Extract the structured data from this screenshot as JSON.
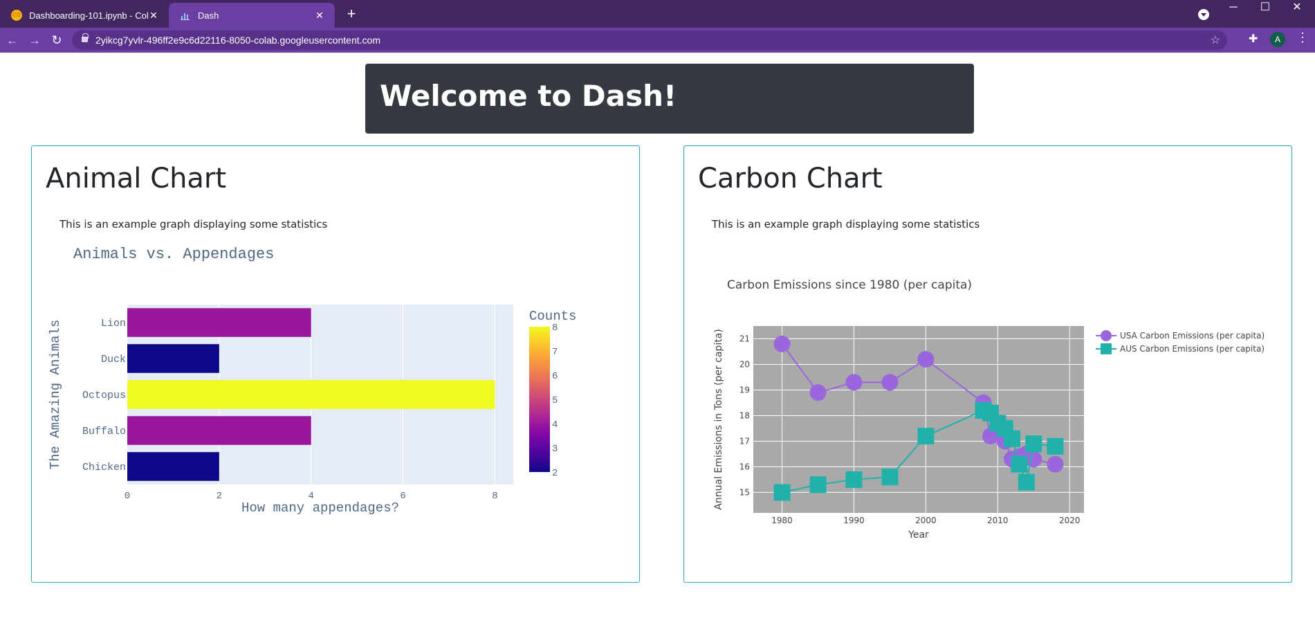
{
  "browser": {
    "tabs": [
      {
        "title": "Dashboarding-101.ipynb - Colab",
        "icon": "colab-icon",
        "active": false
      },
      {
        "title": "Dash",
        "icon": "chart-icon",
        "active": true
      }
    ],
    "url": "2yikcg7yvlr-496ff2e9c6d22116-8050-colab.googleusercontent.com",
    "profile_initial": "A"
  },
  "page": {
    "banner": "Welcome to Dash!",
    "left_card": {
      "title": "Animal Chart",
      "description": "This is an example graph displaying some statistics"
    },
    "right_card": {
      "title": "Carbon Chart",
      "description": "This is an example graph displaying some statistics"
    }
  },
  "colors": {
    "usa": "#9966dd",
    "aus": "#20b2aa",
    "plot_bg_left": "#e5ecf6",
    "plot_bg_right": "#a9a9a9"
  },
  "chart_data": [
    {
      "type": "bar",
      "orientation": "horizontal",
      "title": "Animals vs. Appendages",
      "xlabel": "How many appendages?",
      "ylabel": "The Amazing Animals",
      "categories": [
        "Lion",
        "Duck",
        "Octopus",
        "Buffalo",
        "Chicken"
      ],
      "values": [
        4,
        2,
        8,
        4,
        2
      ],
      "xlim": [
        0,
        8.4
      ],
      "xticks": [
        0,
        2,
        4,
        6,
        8
      ],
      "colorbar": {
        "title": "Counts",
        "range": [
          2,
          8
        ],
        "ticks": [
          2,
          3,
          4,
          5,
          6,
          7,
          8
        ]
      },
      "grid": true
    },
    {
      "type": "line",
      "title": "Carbon Emissions since 1980 (per capita)",
      "xlabel": "Year",
      "ylabel": "Annual Emissions in Tons (per capita)",
      "xlim": [
        1976,
        2022
      ],
      "ylim": [
        14.2,
        21.5
      ],
      "xticks": [
        1980,
        1990,
        2000,
        2010,
        2020
      ],
      "yticks": [
        15,
        16,
        17,
        18,
        19,
        20,
        21
      ],
      "legend": "top-right",
      "grid": true,
      "series": [
        {
          "name": "USA Carbon Emissions (per capita)",
          "marker": "circle",
          "x": [
            1980,
            1985,
            1990,
            1995,
            2000,
            2008,
            2009,
            2010,
            2011,
            2012,
            2013,
            2014,
            2015,
            2018
          ],
          "y": [
            20.8,
            18.9,
            19.3,
            19.3,
            20.2,
            18.5,
            17.2,
            17.6,
            17.0,
            16.3,
            16.4,
            16.5,
            16.3,
            16.1
          ]
        },
        {
          "name": "AUS Carbon Emissions (per capita)",
          "marker": "square",
          "x": [
            1980,
            1985,
            1990,
            1995,
            2000,
            2008,
            2009,
            2010,
            2011,
            2012,
            2013,
            2014,
            2015,
            2018
          ],
          "y": [
            15.0,
            15.3,
            15.5,
            15.6,
            17.2,
            18.2,
            18.1,
            17.7,
            17.5,
            17.1,
            16.1,
            15.4,
            16.9,
            16.8
          ]
        }
      ]
    }
  ]
}
